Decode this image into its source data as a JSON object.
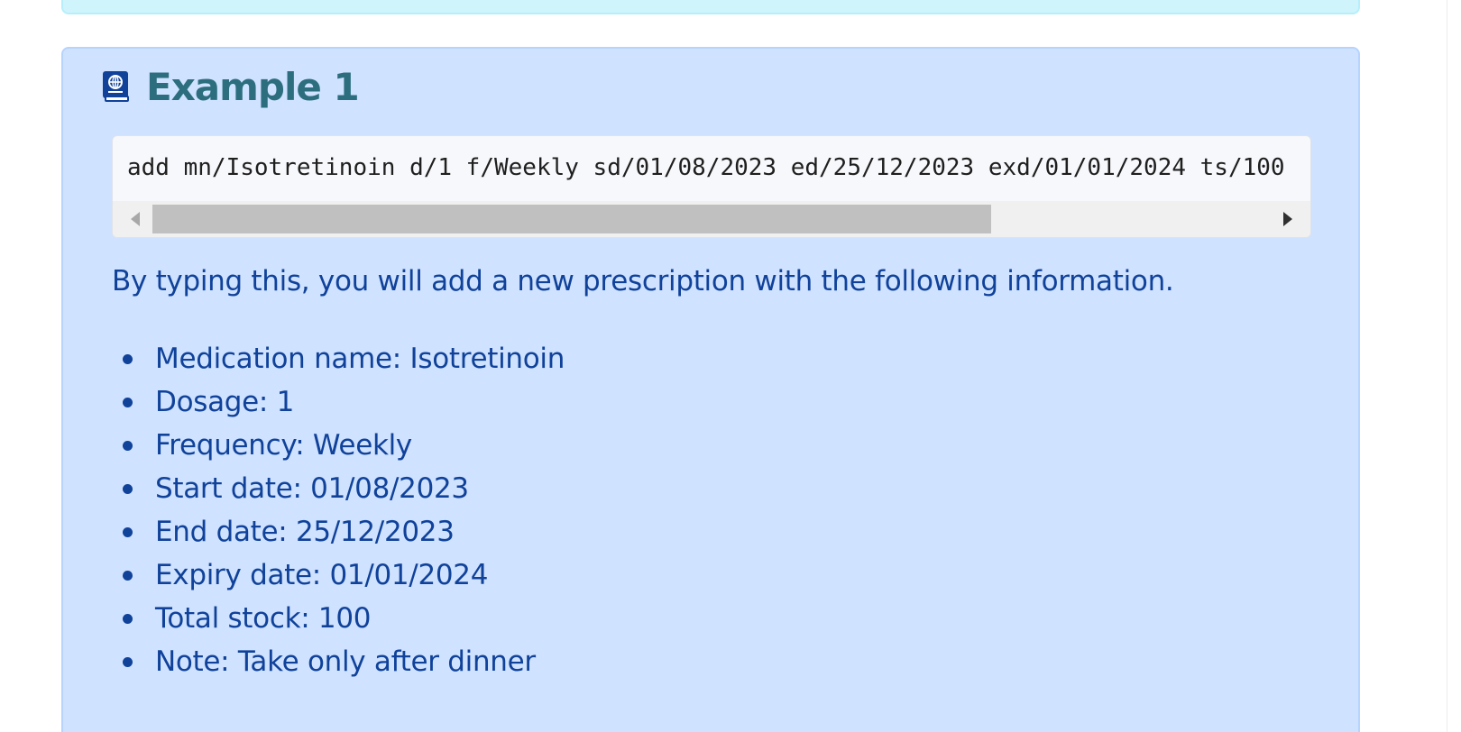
{
  "example": {
    "title": "Example 1",
    "title_icon": "book-globe-icon",
    "command": "add mn/Isotretinoin d/1 f/Weekly sd/01/08/2023 ed/25/12/2023 exd/01/01/2024 ts/100",
    "intro": "By typing this, you will add a new prescription with the following information.",
    "items": [
      {
        "label": "Medication name: Isotretinoin"
      },
      {
        "label": "Dosage: 1"
      },
      {
        "label": "Frequency: Weekly"
      },
      {
        "label": "Start date: 01/08/2023"
      },
      {
        "label": "End date: 25/12/2023"
      },
      {
        "label": "Expiry date: 01/01/2024"
      },
      {
        "label": "Total stock: 100"
      },
      {
        "label": "Note: Take only after dinner"
      }
    ]
  },
  "colors": {
    "example_bg": "#cfe2ff",
    "example_border": "#b6d4fe",
    "prev_box_bg": "#cff4fc",
    "heading_color": "#2d6e7e",
    "text_color": "#10429a",
    "code_bg": "#f7f8fb"
  },
  "icons": {
    "scroll_left": "scroll-left-arrow-icon",
    "scroll_right": "scroll-right-arrow-icon"
  }
}
